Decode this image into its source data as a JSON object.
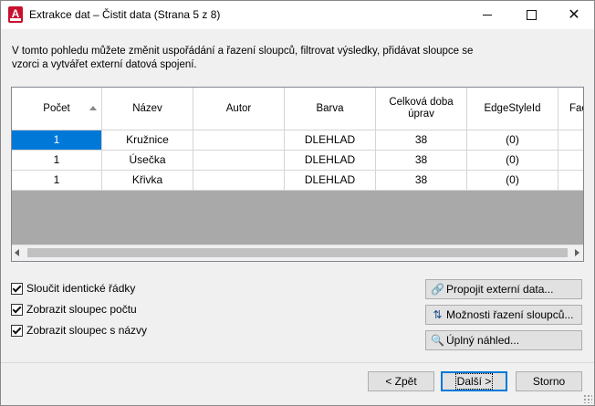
{
  "window": {
    "title": "Extrakce dat – Čistit data (Strana 5 z 8)",
    "app_icon_letter": "A",
    "controls": {
      "minimize": "—",
      "maximize": "☐",
      "close": "✕"
    }
  },
  "description": "V tomto pohledu můžete změnit uspořádání a řazení sloupců, filtrovat výsledky, přidávat sloupce se vzorci a vytvářet externí datová spojení.",
  "table": {
    "headers": [
      "Počet",
      "Název",
      "Autor",
      "Barva",
      "Celková doba úprav",
      "EdgeStyleId",
      "Fac"
    ],
    "rows": [
      [
        "1",
        "Kružnice",
        "",
        "DLEHLAD",
        "38",
        "(0)",
        ""
      ],
      [
        "1",
        "Úsečka",
        "",
        "DLEHLAD",
        "38",
        "(0)",
        ""
      ],
      [
        "1",
        "Křivka",
        "",
        "DLEHLAD",
        "38",
        "(0)",
        ""
      ]
    ],
    "sorted_column": "Počet"
  },
  "checkboxes": [
    {
      "label": "Sloučit identické řádky",
      "checked": true
    },
    {
      "label": "Zobrazit sloupec počtu",
      "checked": true
    },
    {
      "label": "Zobrazit sloupec s názvy",
      "checked": true
    }
  ],
  "side_buttons": [
    {
      "label": "Propojit externí data...",
      "icon": "link-icon"
    },
    {
      "label": "Možnosti řazení sloupců...",
      "icon": "sort-az-icon"
    },
    {
      "label": "Úplný náhled...",
      "icon": "preview-icon"
    }
  ],
  "nav_buttons": {
    "back": "< Zpět",
    "next": "Další >",
    "cancel": "Storno"
  }
}
